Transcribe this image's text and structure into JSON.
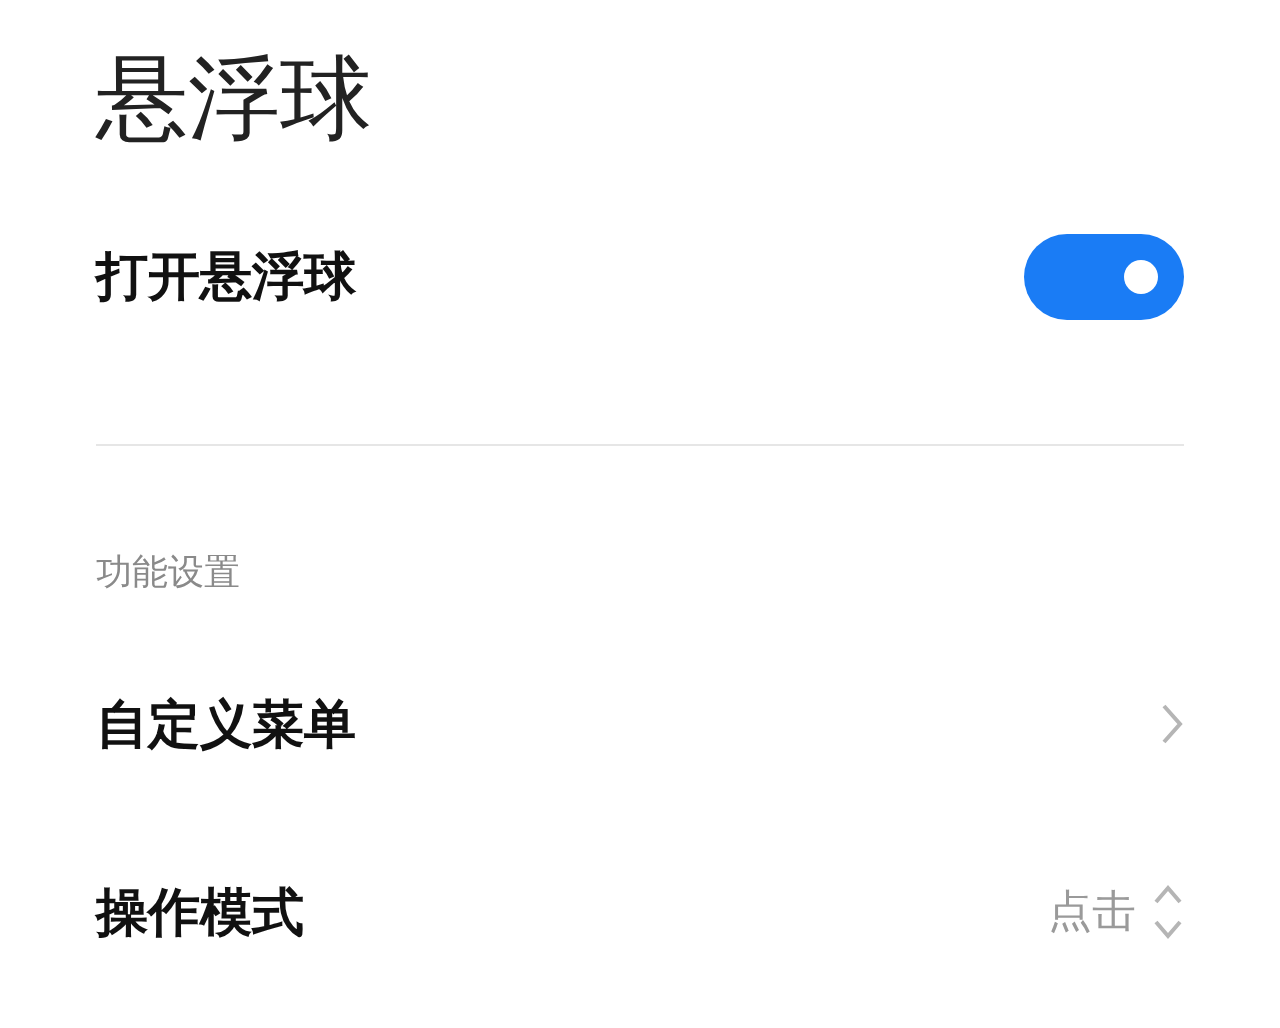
{
  "title": "悬浮球",
  "toggle_row": {
    "label": "打开悬浮球",
    "on": true
  },
  "section": {
    "header": "功能设置",
    "items": [
      {
        "kind": "link",
        "label": "自定义菜单"
      },
      {
        "kind": "select",
        "label": "操作模式",
        "value": "点击"
      }
    ]
  }
}
